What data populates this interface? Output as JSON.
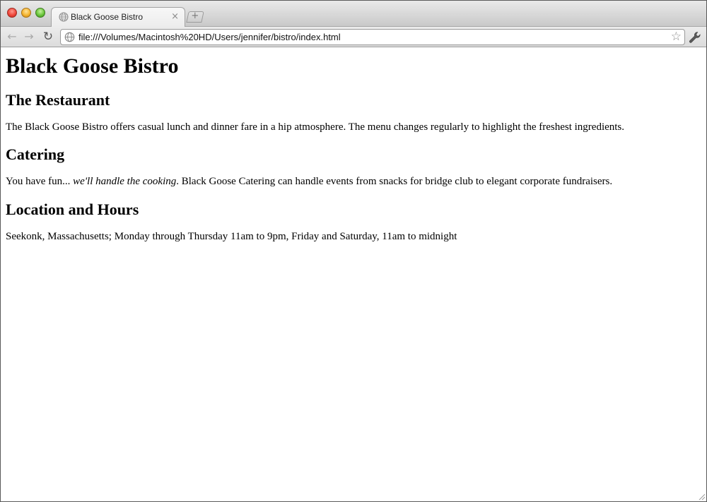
{
  "browser": {
    "tab": {
      "title": "Black Goose Bistro",
      "close_glyph": "×"
    },
    "new_tab_glyph": "+",
    "toolbar": {
      "back_glyph": "←",
      "forward_glyph": "→",
      "reload_glyph": "↻",
      "url": "file:///Volumes/Macintosh%20HD/Users/jennifer/bistro/index.html",
      "star_glyph": "☆"
    },
    "icons": {
      "tab_favicon": "globe-icon",
      "omnibox": "page-icon",
      "menu": "wrench-icon"
    }
  },
  "page": {
    "title": "Black Goose Bistro",
    "sections": {
      "restaurant": {
        "heading": "The Restaurant",
        "text": "The Black Goose Bistro offers casual lunch and dinner fare in a hip atmosphere. The menu changes regularly to highlight the freshest ingredients."
      },
      "catering": {
        "heading": "Catering",
        "text_before": "You have fun... ",
        "text_emphasis": "we'll handle the cooking",
        "text_after": ". Black Goose Catering can handle events from snacks for bridge club to elegant corporate fundraisers."
      },
      "location": {
        "heading": "Location and Hours",
        "text": "Seekonk, Massachusetts; Monday through Thursday 11am to 9pm, Friday and Saturday, 11am to midnight"
      }
    }
  }
}
